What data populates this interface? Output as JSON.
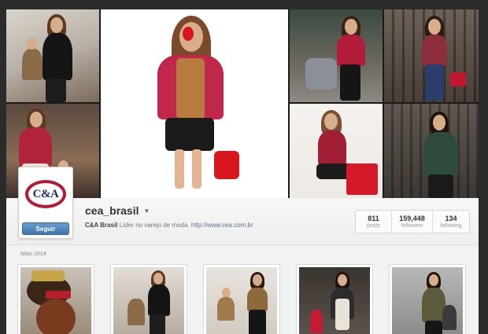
{
  "profile": {
    "username": "cea_brasil",
    "dropdown_icon": "caret-down-icon",
    "bio_name": "C&A Brasil",
    "bio_text": "Líder no varejo de moda.",
    "bio_link": "http://www.cea.com.br",
    "logo_text": "C&A",
    "follow_label": "Seguir"
  },
  "stats": [
    {
      "value": "811",
      "label": "posts"
    },
    {
      "value": "159,448",
      "label": "followers"
    },
    {
      "value": "134",
      "label": "following"
    }
  ],
  "feed": {
    "date_label": "Maio 2014"
  },
  "colors": {
    "brand_red": "#b31b34",
    "brand_navy": "#1c2f6b",
    "follow_blue": "#3f76ad"
  }
}
